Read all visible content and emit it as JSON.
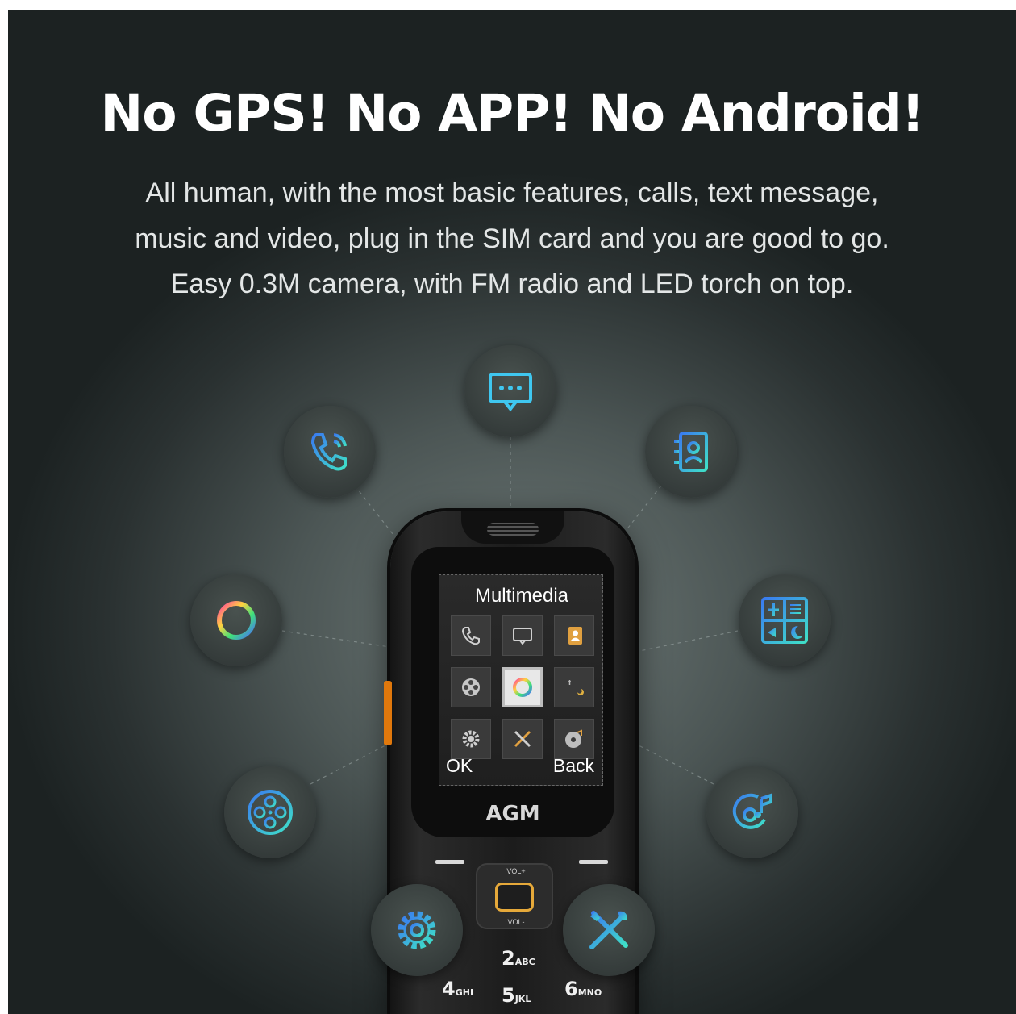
{
  "headline": "No GPS! No APP! No Android!",
  "description": {
    "line1": "All human, with the most basic features, calls, text message,",
    "line2": "music and video, plug in the SIM card and you are good to go.",
    "line3": "Easy 0.3M camera, with FM radio and LED torch on top."
  },
  "phone": {
    "screen_title": "Multimedia",
    "softkey_left": "OK",
    "softkey_right": "Back",
    "brand": "AGM",
    "vol_up": "VOL+",
    "vol_down": "VOL-",
    "keys": [
      {
        "digit": "2",
        "letters": "ABC"
      },
      {
        "digit": "4",
        "letters": "GHI"
      },
      {
        "digit": "5",
        "letters": "JKL"
      },
      {
        "digit": "6",
        "letters": "MNO"
      }
    ]
  },
  "feature_icons": [
    "message-icon",
    "phone-call-icon",
    "contacts-icon",
    "multimedia-ring-icon",
    "profiles-icon",
    "film-reel-icon",
    "music-disc-icon",
    "settings-gear-icon",
    "tools-icon"
  ],
  "colors": {
    "icon_cyan": "#3fc7f0",
    "icon_blue": "#3a7bf0",
    "accent_orange": "#e0780c",
    "nav_gold": "#e6a93a"
  }
}
